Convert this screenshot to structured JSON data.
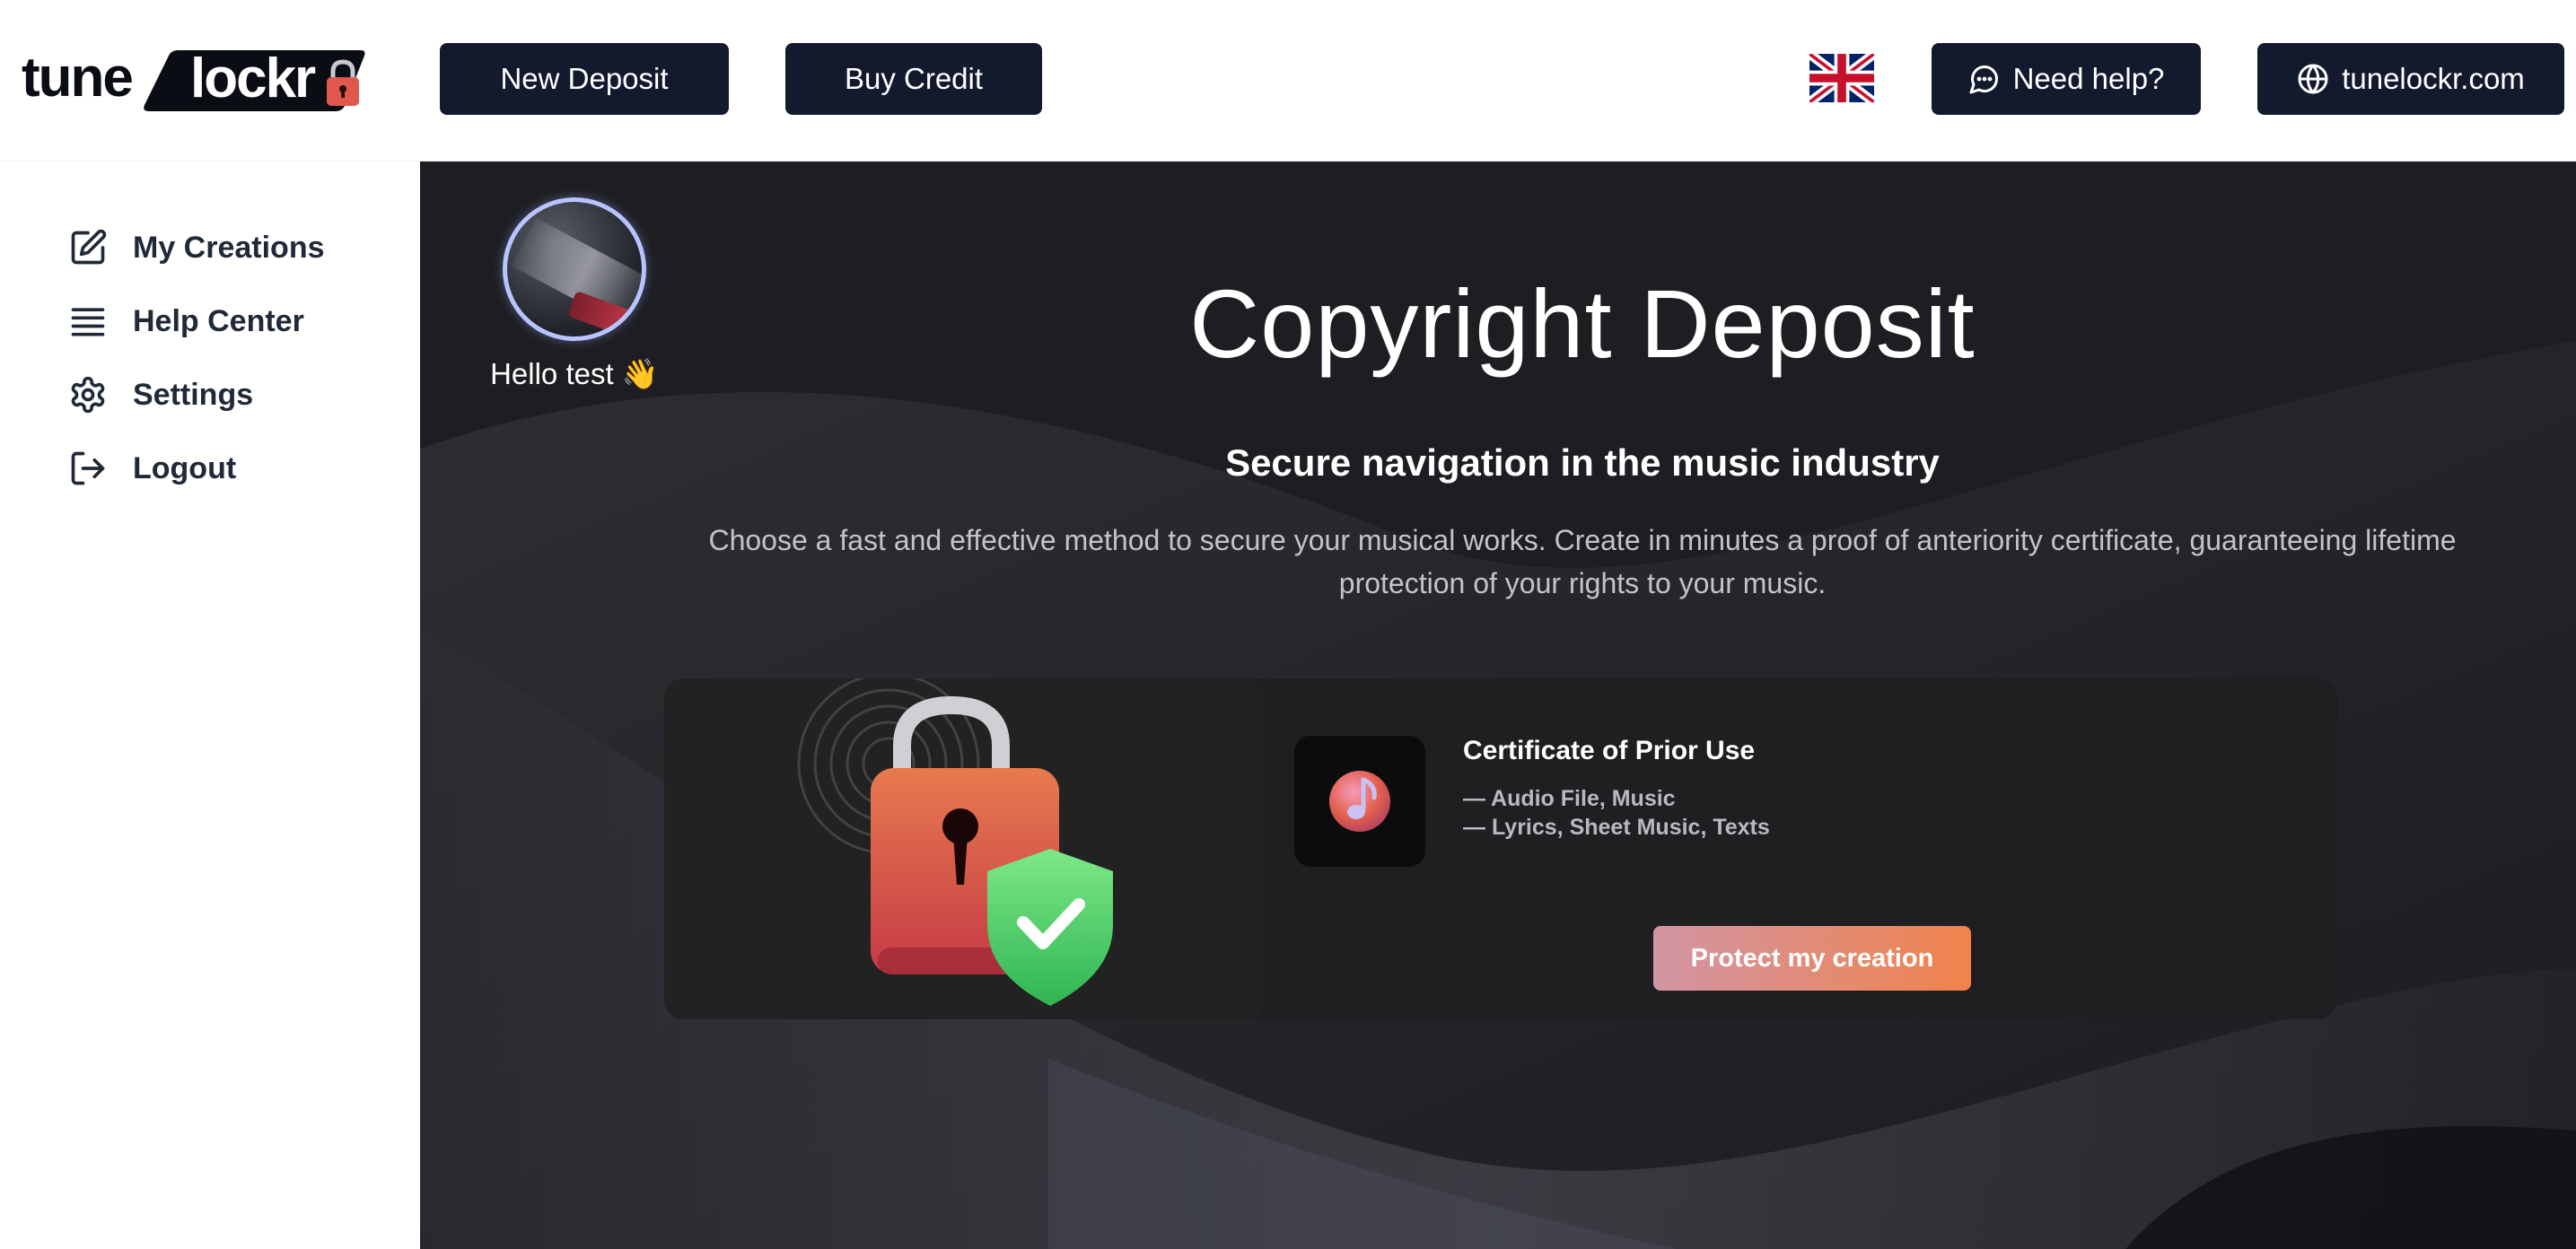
{
  "header": {
    "logo_part1": "tune",
    "logo_part2": "lockr",
    "new_deposit_label": "New Deposit",
    "buy_credit_label": "Buy Credit",
    "language_icon": "uk-flag-icon",
    "help_label": "Need help?",
    "site_label": "tunelockr.com"
  },
  "sidebar": {
    "items": [
      {
        "label": "My Creations",
        "icon": "edit-icon"
      },
      {
        "label": "Help Center",
        "icon": "list-icon"
      },
      {
        "label": "Settings",
        "icon": "gear-icon"
      },
      {
        "label": "Logout",
        "icon": "logout-icon"
      }
    ]
  },
  "main": {
    "greeting": "Hello test 👋",
    "title": "Copyright Deposit",
    "subtitle": "Secure navigation in the music industry",
    "description": "Choose a fast and effective method to secure your musical works. Create in minutes a proof of anteriority certificate, guaranteeing lifetime protection of your rights to your music.",
    "card": {
      "title": "Certificate of Prior Use",
      "line1": "— Audio File, Music",
      "line2": "— Lyrics, Sheet Music, Texts",
      "button_label": "Protect my creation"
    }
  },
  "colors": {
    "dark_button": "#141a2e",
    "main_bg": "#1d1e22",
    "card_bg": "#1f1f21",
    "accent_gradient_start": "#d295a4",
    "accent_gradient_end": "#f0834c"
  }
}
